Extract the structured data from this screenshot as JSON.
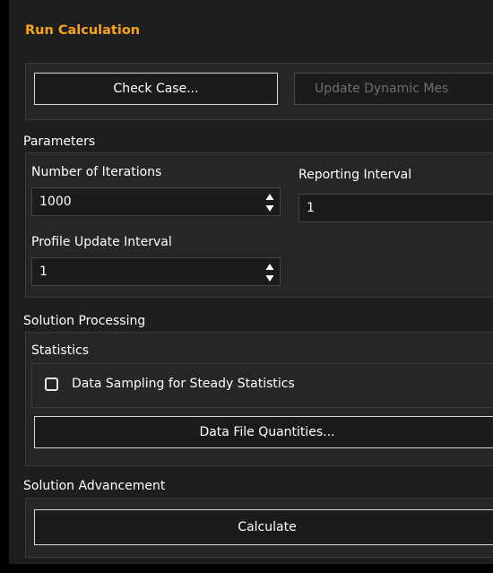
{
  "panel": {
    "title": "Run Calculation",
    "accent_color": "#f7a41b"
  },
  "top_buttons": {
    "check_case": "Check Case...",
    "update_dynamic_mesh": "Update Dynamic Mes"
  },
  "parameters": {
    "group_label": "Parameters",
    "iterations": {
      "label": "Number of Iterations",
      "value": "1000"
    },
    "reporting": {
      "label": "Reporting Interval",
      "value": "1"
    },
    "profile": {
      "label": "Profile Update Interval",
      "value": "1"
    }
  },
  "solution_processing": {
    "group_label": "Solution Processing",
    "statistics": {
      "label": "Statistics",
      "data_sampling_label": "Data Sampling for Steady Statistics",
      "data_sampling_checked": false
    },
    "data_file_button": "Data File Quantities..."
  },
  "solution_advancement": {
    "group_label": "Solution Advancement",
    "calculate_button": "Calculate"
  },
  "icons": {
    "spinner": "spinner-arrows-icon",
    "checkbox": "checkbox-icon"
  }
}
